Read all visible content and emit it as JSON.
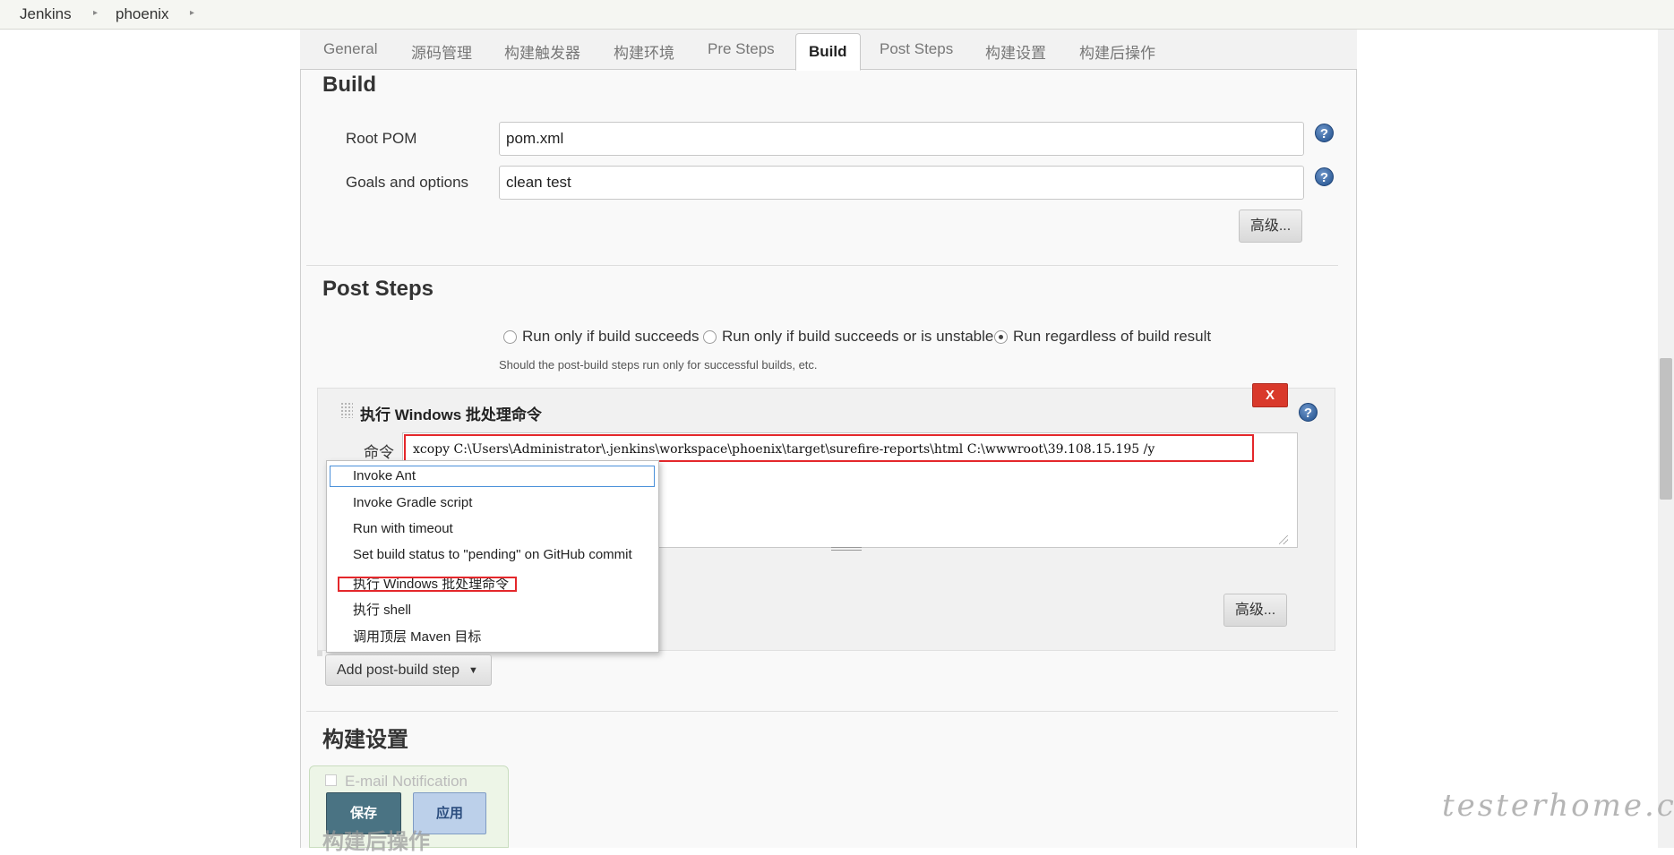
{
  "breadcrumb": {
    "items": [
      "Jenkins",
      "phoenix"
    ]
  },
  "tabs": [
    "General",
    "源码管理",
    "构建触发器",
    "构建环境",
    "Pre Steps",
    "Build",
    "Post Steps",
    "构建设置",
    "构建后操作"
  ],
  "active_tab": "Build",
  "build": {
    "title": "Build",
    "root_pom_label": "Root POM",
    "root_pom_value": "pom.xml",
    "goals_label": "Goals and options",
    "goals_value": "clean test",
    "advanced_label": "高级..."
  },
  "post_steps": {
    "title": "Post Steps",
    "radio_options": [
      "Run only if build succeeds",
      "Run only if build succeeds or is unstable",
      "Run regardless of build result"
    ],
    "selected_option": "Run regardless of build result",
    "hint": "Should the post-build steps run only for successful builds, etc.",
    "step": {
      "title": "执行 Windows 批处理命令",
      "delete_label": "X",
      "command_label": "命令",
      "command_value": "xcopy C:\\Users\\Administrator\\.jenkins\\workspace\\phoenix\\target\\surefire-reports\\html C:\\wwwroot\\39.108.15.195 /y",
      "advanced_label": "高级..."
    },
    "dropdown_items": [
      "Invoke Ant",
      "Invoke Gradle script",
      "Run with timeout",
      "Set build status to \"pending\" on GitHub commit",
      "执行 Windows 批处理命令",
      "执行 shell",
      "调用顶层 Maven 目标"
    ],
    "add_step_label": "Add post-build step"
  },
  "build_settings": {
    "title": "构建设置",
    "email_label": "E-mail Notification"
  },
  "post_build_title": "构建后操作",
  "actions": {
    "save_label": "保存",
    "apply_label": "应用"
  },
  "watermark": "testerhome.com",
  "colors": {
    "highlight": "#e4272b",
    "save": "#4a7383",
    "delete": "#d9392b"
  }
}
